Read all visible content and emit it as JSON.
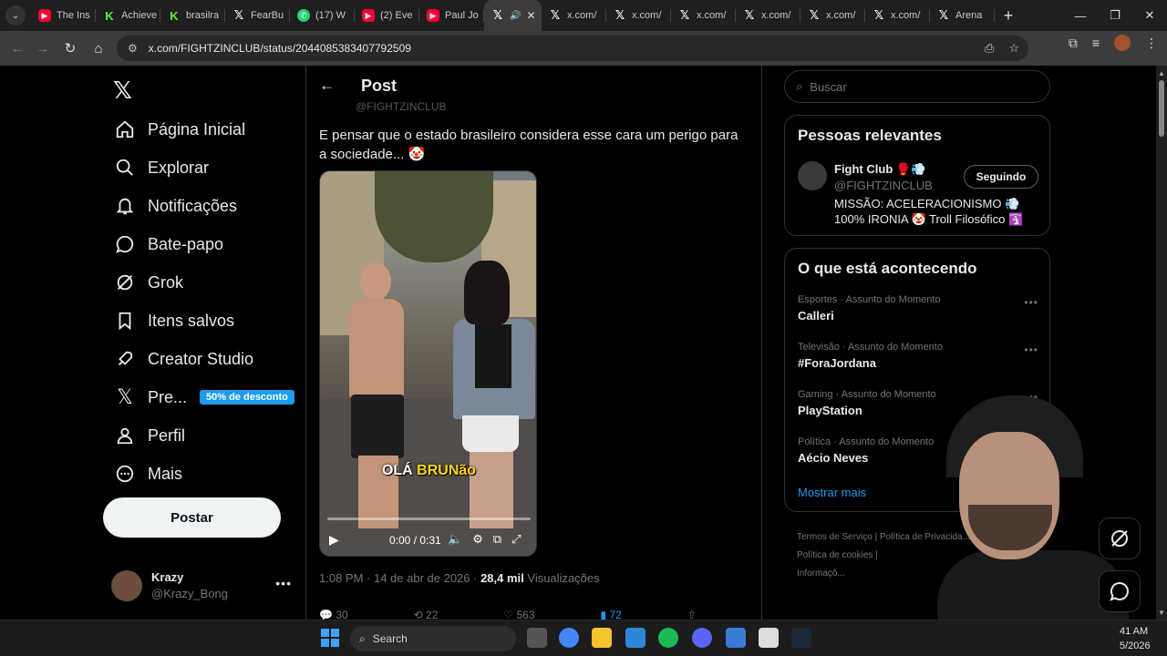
{
  "browser": {
    "tabs": [
      {
        "label": "The Ins",
        "favicon": "youtube-icon"
      },
      {
        "label": "Achieve",
        "favicon": "kick-icon"
      },
      {
        "label": "brasilra",
        "favicon": "kick-icon"
      },
      {
        "label": "FearBu",
        "favicon": "x-icon"
      },
      {
        "label": "(17) W",
        "favicon": "whatsapp-icon"
      },
      {
        "label": "(2) Eve",
        "favicon": "youtube-icon"
      },
      {
        "label": "Paul Jo",
        "favicon": "youtube-icon"
      },
      {
        "label": "",
        "favicon": "x-icon",
        "active": true
      },
      {
        "label": "x.com/",
        "favicon": "x-icon"
      },
      {
        "label": "x.com/",
        "favicon": "x-icon"
      },
      {
        "label": "x.com/",
        "favicon": "x-icon"
      },
      {
        "label": "x.com/",
        "favicon": "x-icon"
      },
      {
        "label": "x.com/",
        "favicon": "x-icon"
      },
      {
        "label": "x.com/",
        "favicon": "x-icon"
      },
      {
        "label": "Arena",
        "favicon": "x-icon"
      }
    ],
    "url": "x.com/FIGHTZINCLUB/status/2044085383407792509"
  },
  "nav": {
    "items": [
      {
        "label": "Página Inicial",
        "icon": "home-icon"
      },
      {
        "label": "Explorar",
        "icon": "search-icon"
      },
      {
        "label": "Notificações",
        "icon": "bell-icon"
      },
      {
        "label": "Bate-papo",
        "icon": "chat-icon"
      },
      {
        "label": "Grok",
        "icon": "grok-icon"
      },
      {
        "label": "Itens salvos",
        "icon": "bookmark-icon"
      },
      {
        "label": "Creator Studio",
        "icon": "rocket-icon"
      },
      {
        "label": "Pre...",
        "icon": "x-icon"
      },
      {
        "label": "Perfil",
        "icon": "person-icon"
      },
      {
        "label": "Mais",
        "icon": "more-circle-icon"
      }
    ],
    "premium_badge": "50% de desconto",
    "post_button": "Postar",
    "account": {
      "name": "Krazy",
      "handle": "@Krazy_Bong"
    }
  },
  "post": {
    "header_title": "Post",
    "faded_handle": "@FIGHTZINCLUB",
    "text": "E pensar que o estado brasileiro considera esse cara um perigo para a sociedade... 🤡",
    "video": {
      "caption_start": "OLÁ ",
      "caption_highlight": "BRUNão",
      "time": "0:00 / 0:31",
      "progress": 0
    },
    "meta_time": "1:08 PM · 14 de abr de 2026 · ",
    "meta_views_count": "28,4 mil",
    "meta_views_label": " Visualizações",
    "actions": {
      "replies": "30",
      "reposts": "22",
      "likes": "563",
      "bookmarks": "72"
    }
  },
  "right": {
    "search_placeholder": "Buscar",
    "relevant": {
      "title": "Pessoas relevantes",
      "name": "Fight Club 🥊💨",
      "handle": "@FIGHTZINCLUB",
      "bio": "MISSÃO: ACELERACIONISMO 💨 100% IRONIA 🤡 Troll Filosófico 🛐",
      "follow_label": "Seguindo"
    },
    "trending": {
      "title": "O que está acontecendo",
      "items": [
        {
          "category": "Esportes · Assunto do Momento",
          "name": "Calleri"
        },
        {
          "category": "Televisão · Assunto do Momento",
          "name": "#ForaJordana"
        },
        {
          "category": "Gaming · Assunto do Momento",
          "name": "PlayStation"
        },
        {
          "category": "Política · Assunto do Momento",
          "name": "Aécio Neves"
        }
      ],
      "show_more": "Mostrar mais"
    },
    "footer": {
      "line1": "Termos de Serviço  |  Política de Privacida...",
      "line2": "Política de cookies  |",
      "line3": "Informaçõ..."
    }
  },
  "taskbar": {
    "search_label": "Search",
    "clock_time": "41 AM",
    "clock_date": "5/2026"
  },
  "colors": {
    "accent": "#1d9bf0",
    "background": "#000000",
    "border": "#2f3336",
    "muted": "#71767b"
  }
}
